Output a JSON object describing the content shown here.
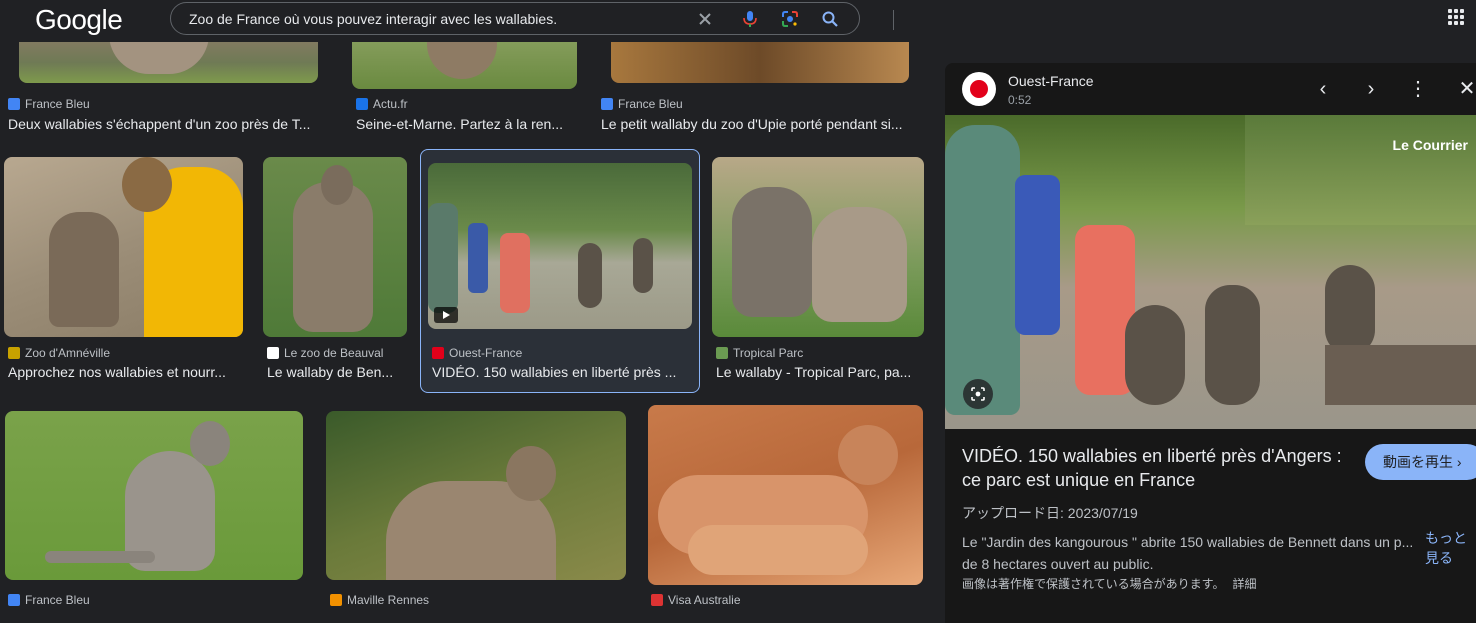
{
  "header": {
    "logo": "Google",
    "search_value": "Zoo de France où vous pouvez interagir avec les wallabies."
  },
  "results": [
    {
      "source": "France Bleu",
      "title": "Deux wallabies s'échappent d'un zoo près de T...",
      "fav": "#4285f4"
    },
    {
      "source": "Actu.fr",
      "title": "Seine-et-Marne. Partez à la ren...",
      "fav": "#1a73e8"
    },
    {
      "source": "France Bleu",
      "title": "Le petit wallaby du zoo d'Upie porté pendant si...",
      "fav": "#4285f4"
    },
    {
      "source": "Zoo d'Amnéville",
      "title": "Approchez nos wallabies et nourr...",
      "fav": "#c8a200"
    },
    {
      "source": "Le zoo de Beauval",
      "title": "Le wallaby de Ben...",
      "fav": "#ffffff"
    },
    {
      "source": "Ouest-France",
      "title": "VIDÉO. 150 wallabies en liberté près ...",
      "fav": "#e2001a"
    },
    {
      "source": "Tropical Parc",
      "title": "Le wallaby - Tropical Parc, pa...",
      "fav": "#6b9b52"
    },
    {
      "source": "France Bleu",
      "title": "",
      "fav": "#4285f4"
    },
    {
      "source": "Maville Rennes",
      "title": "",
      "fav": "#f29100"
    },
    {
      "source": "Visa Australie",
      "title": "",
      "fav": "#d33"
    }
  ],
  "panel": {
    "source": "Ouest-France",
    "duration": "0:52",
    "watermark": "Le Courrier",
    "title": "VIDÉO. 150 wallabies en liberté près d'Angers : ce parc est unique en France",
    "play_label": "動画を再生 ›",
    "upload": "アップロード日: 2023/07/19",
    "description": "Le \"Jardin des kangourous \" abrite 150 wallabies de Bennett dans un p... de 8 hectares ouvert au public.",
    "more": "もっと見る",
    "copyright": "画像は著作権で保護されている場合があります。",
    "details": "詳細"
  }
}
